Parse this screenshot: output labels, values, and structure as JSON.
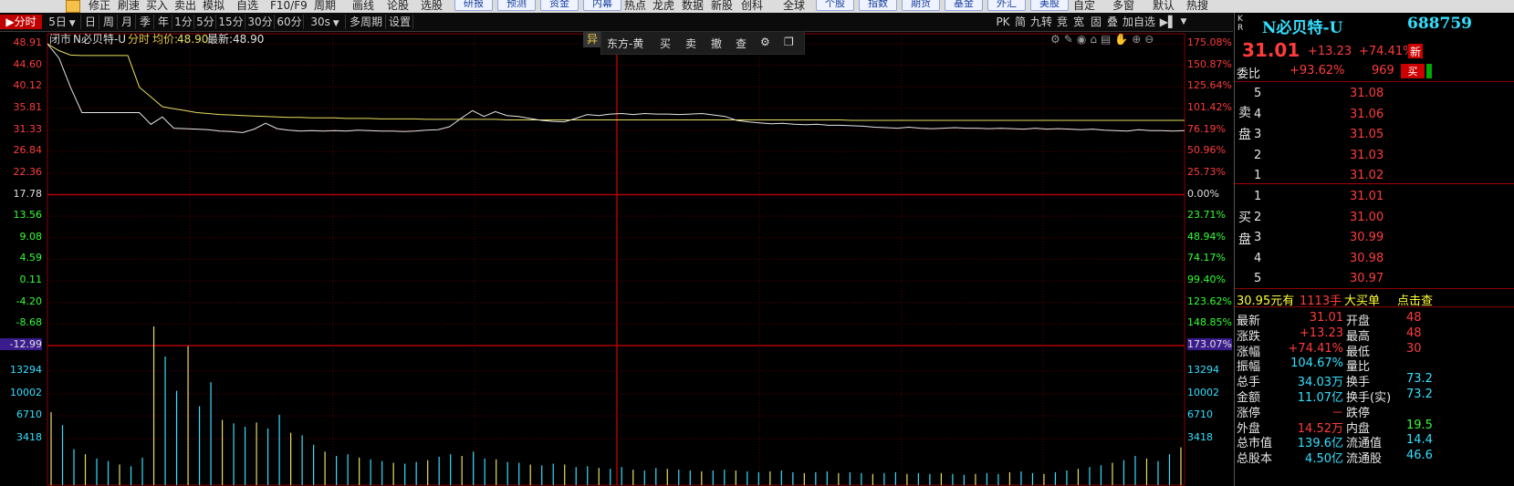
{
  "toolbar": {
    "items": [
      "修正",
      "刷速",
      "买入",
      "卖出",
      "模拟",
      "自选",
      "F10/F9",
      "周期",
      "画线",
      "论股",
      "选股"
    ],
    "buttons": [
      "研报",
      "预测",
      "资金",
      "内幕"
    ],
    "items2": [
      "热点",
      "龙虎",
      "数据",
      "新股",
      "创科"
    ],
    "items3": [
      "全球"
    ],
    "buttons2": [
      "个股",
      "指数",
      "期货",
      "基金",
      "外汇",
      "美股"
    ],
    "items4": [
      "自定",
      "多窗",
      "默认",
      "热搜"
    ]
  },
  "period_bar": {
    "items": [
      "分时",
      "5日",
      "日",
      "周",
      "月",
      "季",
      "年",
      "1分",
      "5分",
      "15分",
      "30分",
      "60分",
      "30s",
      "多周期",
      "设置"
    ],
    "active": "分时",
    "right_items": [
      "PK",
      "简",
      "九转",
      "竞",
      "宽",
      "固",
      "叠",
      "加自选"
    ]
  },
  "chart_header": {
    "status": "闭市",
    "name": "N必贝特-U",
    "mode": "分时",
    "avg_label": "均价:",
    "avg_value": "48.90",
    "last_label": "最新:",
    "last_value": "48.90"
  },
  "floating_toolbar": {
    "badge": "异",
    "account": "东方-黄",
    "actions": [
      "买",
      "卖",
      "撤",
      "查"
    ]
  },
  "price_axis": {
    "left": [
      "48.91",
      "44.60",
      "40.12",
      "35.81",
      "31.33",
      "26.84",
      "22.36",
      "17.78",
      "13.56",
      "9.08",
      "4.59",
      "0.11",
      "-4.20",
      "-8.68",
      "-12.99"
    ],
    "right": [
      "175.08%",
      "150.87%",
      "125.64%",
      "101.42%",
      "76.19%",
      "50.96%",
      "25.73%",
      "0.00%",
      "23.71%",
      "48.94%",
      "74.17%",
      "99.40%",
      "123.62%",
      "148.85%",
      "173.07%"
    ],
    "prev_close": "17.78"
  },
  "volume_axis": {
    "labels": [
      "13294",
      "10002",
      "6710",
      "3418"
    ]
  },
  "chart_data": {
    "type": "line",
    "series": [
      {
        "name": "",
        "values": [
          48.9,
          47.5,
          46.6,
          46.5,
          46.5,
          46.5,
          46.5,
          46.5,
          40.0,
          38.0,
          36.0,
          35.6,
          35.2,
          34.8,
          34.6,
          34.4,
          34.3,
          34.2,
          34.1,
          34.0,
          33.9,
          33.8,
          33.8,
          33.7,
          33.7,
          33.7,
          33.6,
          33.6,
          33.6,
          33.5,
          33.5,
          33.5,
          33.5,
          33.4,
          33.4,
          33.4,
          33.4,
          33.4,
          33.4,
          33.4,
          33.3,
          33.3,
          33.3,
          33.3,
          33.3,
          33.3,
          33.3,
          33.3,
          33.3,
          33.3,
          33.3,
          33.3,
          33.3,
          33.3,
          33.3,
          33.3,
          33.3,
          33.3,
          33.3,
          33.3,
          33.3,
          33.3,
          33.3,
          33.3,
          33.3,
          33.3,
          33.3,
          33.3,
          33.3,
          33.3,
          33.2,
          33.2,
          33.2,
          33.2,
          33.2,
          33.2,
          33.2,
          33.2,
          33.2,
          33.2,
          33.2,
          33.2,
          33.2,
          33.2,
          33.2,
          33.2,
          33.2,
          33.2,
          33.2,
          33.2,
          33.2,
          33.2,
          33.2,
          33.2,
          33.2,
          33.2,
          33.2,
          33.2,
          33.2,
          33.2
        ]
      },
      {
        "name": "",
        "values": [
          48.9,
          46.0,
          40.0,
          34.8,
          34.8,
          34.8,
          34.8,
          34.8,
          34.8,
          32.4,
          33.9,
          31.6,
          31.5,
          31.4,
          31.3,
          31.0,
          30.9,
          30.7,
          31.4,
          32.6,
          31.5,
          31.2,
          31.0,
          31.1,
          31.0,
          31.1,
          31.0,
          31.2,
          31.1,
          31.0,
          31.0,
          30.9,
          31.0,
          31.2,
          31.3,
          31.9,
          33.6,
          35.2,
          34.0,
          35.0,
          34.2,
          34.0,
          33.6,
          33.2,
          33.0,
          32.9,
          33.6,
          34.4,
          34.2,
          34.5,
          34.6,
          34.4,
          34.6,
          34.5,
          34.5,
          34.4,
          34.5,
          34.6,
          34.3,
          34.0,
          33.2,
          32.9,
          32.7,
          32.5,
          32.6,
          32.4,
          32.3,
          32.4,
          32.2,
          32.2,
          32.1,
          32.0,
          31.8,
          31.7,
          31.6,
          31.8,
          31.6,
          31.5,
          31.6,
          31.7,
          31.6,
          31.6,
          31.5,
          31.6,
          31.5,
          31.4,
          31.6,
          31.4,
          31.5,
          31.4,
          31.3,
          31.4,
          31.2,
          31.1,
          31.0,
          31.3,
          31.1,
          31.1,
          31.0,
          31.1
        ]
      }
    ],
    "volumes": [
      8500,
      7000,
      4200,
      3600,
      3100,
      2800,
      2400,
      2200,
      3200,
      18500,
      15000,
      11000,
      16200,
      9200,
      12000,
      7600,
      7200,
      6800,
      7300,
      6600,
      8200,
      6100,
      5800,
      4700,
      3900,
      3400,
      3600,
      3200,
      3000,
      2800,
      2600,
      2500,
      2700,
      2900,
      3300,
      3600,
      3400,
      3900,
      3100,
      3000,
      2700,
      2600,
      2400,
      2300,
      2500,
      2400,
      2100,
      2200,
      2000,
      1900,
      2100,
      1800,
      1700,
      2000,
      1900,
      1800,
      1700,
      1600,
      1700,
      1800,
      1700,
      1600,
      1500,
      1600,
      1700,
      1500,
      1400,
      1500,
      1600,
      1400,
      1500,
      1400,
      1300,
      1400,
      1500,
      1300,
      1400,
      1300,
      1400,
      1300,
      1200,
      1300,
      1400,
      1300,
      1500,
      1600,
      1400,
      1300,
      1500,
      1700,
      1900,
      2100,
      2300,
      2600,
      2900,
      3400,
      3100,
      2800,
      3600,
      4400
    ],
    "ylim": [
      -12.99,
      48.91
    ],
    "prev_close": 17.78,
    "grid": true
  },
  "quote": {
    "name": "N必贝特-U",
    "code": "688759",
    "kr": "K\nR",
    "price": "31.01",
    "change": "+13.23",
    "pct": "+74.41%",
    "tag": "新",
    "weibi_label": "委比",
    "weibi_pct": "+93.62%",
    "weibi_diff": "969",
    "sell_label": "卖盘",
    "buy_label": "买盘",
    "sell": [
      {
        "lvl": "5",
        "price": "31.08"
      },
      {
        "lvl": "4",
        "price": "31.06"
      },
      {
        "lvl": "3",
        "price": "31.05"
      },
      {
        "lvl": "2",
        "price": "31.03"
      },
      {
        "lvl": "1",
        "price": "31.02"
      }
    ],
    "buy": [
      {
        "lvl": "1",
        "price": "31.01"
      },
      {
        "lvl": "2",
        "price": "31.00"
      },
      {
        "lvl": "3",
        "price": "30.99"
      },
      {
        "lvl": "4",
        "price": "30.98"
      },
      {
        "lvl": "5",
        "price": "30.97"
      }
    ],
    "bigorder": {
      "price": "30.95元有",
      "qty": "1113手",
      "label": "大买单",
      "link": "点击查"
    },
    "stats_left": [
      {
        "k": "最新",
        "v": "31.01"
      },
      {
        "k": "涨跌",
        "v": "+13.23"
      },
      {
        "k": "涨幅",
        "v": "+74.41%"
      },
      {
        "k": "振幅",
        "v": "104.67%"
      },
      {
        "k": "总手",
        "v": "34.03万"
      },
      {
        "k": "金额",
        "v": "11.07亿"
      },
      {
        "k": "涨停",
        "v": "－"
      },
      {
        "k": "外盘",
        "v": "14.52万"
      },
      {
        "k": "总市值",
        "v": "139.6亿"
      },
      {
        "k": "总股本",
        "v": "4.50亿"
      }
    ],
    "stats_right": [
      {
        "k": "开盘",
        "v": "48"
      },
      {
        "k": "最高",
        "v": "48"
      },
      {
        "k": "最低",
        "v": "30"
      },
      {
        "k": "量比",
        "v": ""
      },
      {
        "k": "换手",
        "v": "73.2"
      },
      {
        "k": "换手(实)",
        "v": "73.2"
      },
      {
        "k": "跌停",
        "v": ""
      },
      {
        "k": "内盘",
        "v": "19.5"
      },
      {
        "k": "流通值",
        "v": "14.4"
      },
      {
        "k": "流通股",
        "v": "46.6"
      }
    ]
  }
}
